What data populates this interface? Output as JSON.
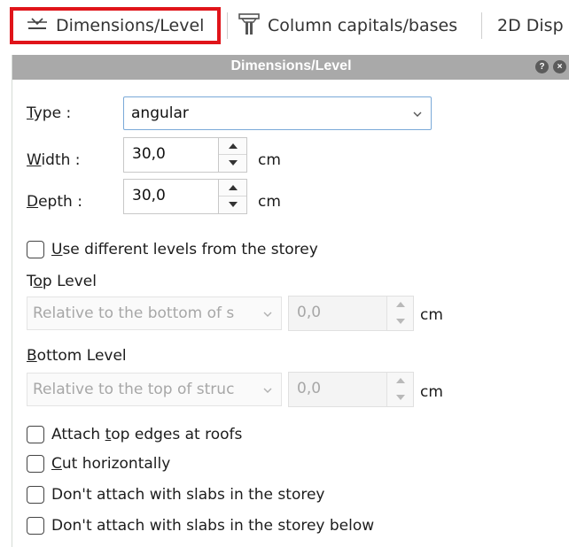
{
  "tabs": [
    {
      "label": "Dimensions/Level",
      "icon": "dimension-level-icon",
      "active": true,
      "highlight_color": "#e0141a"
    },
    {
      "label": "Column capitals/bases",
      "icon": "column-capital-icon",
      "active": false
    },
    {
      "label": "2D Disp",
      "icon": "",
      "active": false
    }
  ],
  "panel": {
    "title": "Dimensions/Level",
    "header_color": "#a9a9a9",
    "help_icon": "help-icon",
    "close_icon": "close-icon"
  },
  "form": {
    "type": {
      "label_mnemonic": "T",
      "label_rest": "ype :",
      "value": "angular"
    },
    "width": {
      "label_mnemonic": "W",
      "label_rest": "idth :",
      "value": "30,0",
      "unit": "cm"
    },
    "depth": {
      "label_mnemonic": "D",
      "label_rest": "epth :",
      "value": "30,0",
      "unit": "cm"
    },
    "use_levels": {
      "mnemonic": "U",
      "rest": "se different levels from the storey",
      "checked": false
    },
    "top_level": {
      "heading_pre": "T",
      "heading_mnemonic": "o",
      "heading_rest": "p Level",
      "relative": "Relative to the bottom of s",
      "value": "0,0",
      "unit": "cm"
    },
    "bottom_level": {
      "heading_mnemonic": "B",
      "heading_rest": "ottom Level",
      "relative": "Relative to the top of struc",
      "value": "0,0",
      "unit": "cm"
    },
    "checks": [
      {
        "pre": "Attach ",
        "mnemonic": "t",
        "rest": "op edges at roofs",
        "checked": false
      },
      {
        "pre": "",
        "mnemonic": "C",
        "rest": "ut horizontally",
        "checked": false
      },
      {
        "pre": "Don't attach with slabs in the storey",
        "mnemonic": "",
        "rest": "",
        "checked": false
      },
      {
        "pre": "Don't attach with slabs in the storey below",
        "mnemonic": "",
        "rest": "",
        "checked": false
      }
    ]
  }
}
